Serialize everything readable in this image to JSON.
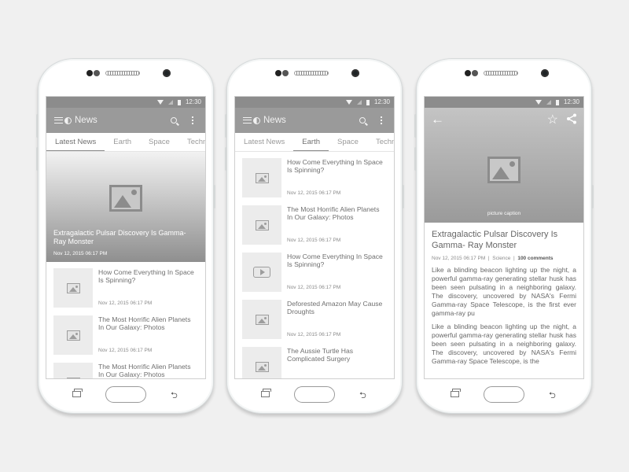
{
  "status_bar": {
    "time": "12:30"
  },
  "app": {
    "title": "News"
  },
  "tabs": [
    "Latest News",
    "Earth",
    "Space",
    "Techn"
  ],
  "screen1": {
    "active_tab": 0,
    "hero": {
      "title": "Extragalactic Pulsar Discovery Is Gamma-Ray Monster",
      "date": "Nov 12, 2015 06:17 PM"
    },
    "items": [
      {
        "title": "How Come Everything In Space Is Spinning?",
        "date": "Nov 12, 2015 06:17 PM",
        "media": "image"
      },
      {
        "title": "The Most Horrific Alien Planets In Our Galaxy: Photos",
        "date": "Nov 12, 2015 06:17 PM",
        "media": "image"
      },
      {
        "title": "The Most Horrific Alien Planets In Our Galaxy: Photos",
        "date": "",
        "media": "image"
      }
    ]
  },
  "screen2": {
    "active_tab": 1,
    "items": [
      {
        "title": "How Come Everything In Space Is Spinning?",
        "date": "Nov 12, 2015 06:17 PM",
        "media": "image"
      },
      {
        "title": "The Most Horrific Alien Planets In Our Galaxy: Photos",
        "date": "Nov 12, 2015 06:17 PM",
        "media": "image"
      },
      {
        "title": "How Come Everything In Space Is Spinning?",
        "date": "Nov 12, 2015 06:17 PM",
        "media": "video"
      },
      {
        "title": "Deforested Amazon May Cause Droughts",
        "date": "Nov 12, 2015 06:17 PM",
        "media": "image"
      },
      {
        "title": "The Aussie Turtle Has Complicated Surgery",
        "date": "",
        "media": "image"
      }
    ]
  },
  "screen3": {
    "caption": "picture caption",
    "title": "Extragalactic Pulsar Discovery Is Gamma- Ray Monster",
    "date": "Nov 12, 2015 06:17 PM",
    "separator": "|",
    "category": "Science",
    "comments": "100 comments",
    "paragraphs": [
      "Like a blinding beacon lighting up the night, a powerful gamma-ray generating stellar husk has been seen pulsating in a neighboring galaxy. The discovery, uncovered by NASA's Fermi Gamma-ray Space Telescope, is the first ever gamma-ray pu",
      "Like a blinding beacon lighting up the night, a powerful gamma-ray generating stellar husk has been seen pulsating in a neighboring galaxy. The discovery, uncovered by NASA's Fermi Gamma-ray Space Telescope, is the"
    ]
  },
  "icons": {
    "back": "←",
    "star": "☆",
    "share": "share-icon",
    "nav_back": "⮌"
  }
}
